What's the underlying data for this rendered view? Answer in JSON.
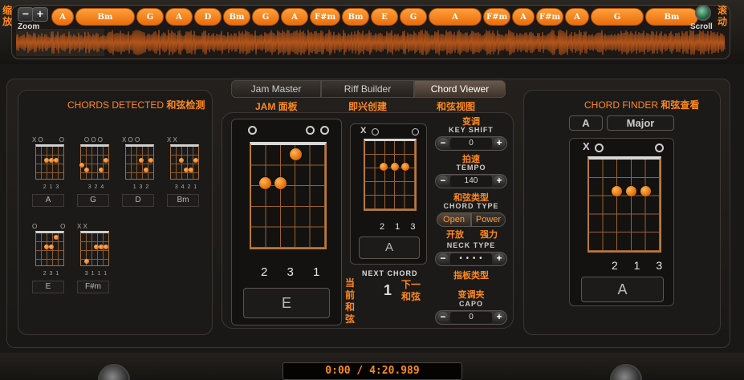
{
  "top": {
    "zoom_cn": "缩放",
    "zoom_label": "Zoom",
    "scroll_cn": "滚动",
    "scroll_label": "Scroll",
    "minus": "−",
    "plus": "+",
    "chords": [
      "A",
      "Bm",
      "G",
      "A",
      "D",
      "Bm",
      "G",
      "A",
      "F#m",
      "Bm",
      "E",
      "G",
      "A",
      "F#m",
      "A",
      "F#m",
      "A",
      "G",
      "Bm"
    ]
  },
  "tabs": {
    "items": [
      "Jam Master",
      "Riff Builder",
      "Chord Viewer"
    ],
    "active": "Chord Viewer",
    "sub": [
      "JAM 面板",
      "即兴创建",
      "和弦视图"
    ]
  },
  "detected": {
    "title_en": "CHORDS DETECTED",
    "title_cn": "和弦检测",
    "chords": [
      {
        "name": "A",
        "marks": "X O         O",
        "fingers": "2 1 3"
      },
      {
        "name": "G",
        "marks": "    O O O",
        "fingers": "3 2       4"
      },
      {
        "name": "D",
        "marks": "X O O",
        "fingers": "1 3 2"
      },
      {
        "name": "Bm",
        "marks": "X X",
        "fingers": "3 4 2 1"
      },
      {
        "name": "E",
        "marks": "O             O",
        "fingers": "2 3 1"
      },
      {
        "name": "F#m",
        "marks": "X X",
        "fingers": "3 1 1 1"
      }
    ]
  },
  "current": {
    "name": "E",
    "fingers": "2 3 1",
    "label_cn": [
      "当",
      "前",
      "和",
      "弦"
    ]
  },
  "next": {
    "name": "A",
    "fingers": "2 1 3",
    "label": "NEXT CHORD",
    "count": "1",
    "label_cn": [
      "下一",
      "和弦"
    ]
  },
  "controls": {
    "key_shift_cn": "变调",
    "key_shift": "KEY SHIFT",
    "key_shift_value": "0",
    "tempo_cn": "拍速",
    "tempo": "TEMPO",
    "tempo_value": "140",
    "chord_type_cn": "和弦类型",
    "chord_type": "CHORD TYPE",
    "open": "Open",
    "power": "Power",
    "open_cn": "开放",
    "power_cn": "强力",
    "neck_type": "NECK TYPE",
    "neck_value": "• • • •",
    "neck_type_cn": "指板类型",
    "capo_cn": "变调夹",
    "capo": "CAPO",
    "capo_value": "0"
  },
  "finder": {
    "title_en": "CHORD FINDER",
    "title_cn": "和弦查看",
    "root": "A",
    "quality": "Major",
    "name": "A",
    "fingers": "2 1 3"
  },
  "time": "0:00 / 4:20.989"
}
